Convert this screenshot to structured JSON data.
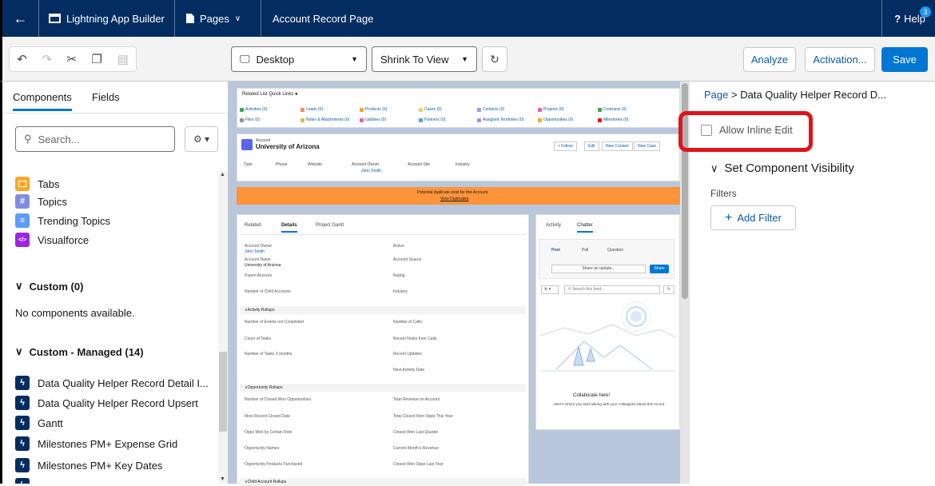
{
  "topbar": {
    "app_title": "Lightning App Builder",
    "pages_label": "Pages",
    "record_title": "Account Record Page",
    "help_label": "Help",
    "help_badge": "3"
  },
  "toolbar": {
    "device": "Desktop",
    "view": "Shrink To View",
    "analyze": "Analyze",
    "activation": "Activation...",
    "save": "Save"
  },
  "left": {
    "tab_components": "Components",
    "tab_fields": "Fields",
    "search_placeholder": "Search...",
    "items": [
      {
        "label": "Tabs",
        "color": "#f9a825",
        "glyph": ""
      },
      {
        "label": "Topics",
        "color": "#7f8de1",
        "glyph": "#"
      },
      {
        "label": "Trending Topics",
        "color": "#5a9cff",
        "glyph": "≡"
      },
      {
        "label": "Visualforce",
        "color": "#9c27e0",
        "glyph": "</>"
      }
    ],
    "custom_header": "Custom (0)",
    "no_components": "No components available.",
    "managed_header": "Custom - Managed (14)",
    "managed_items": [
      "Data Quality Helper Record Detail I...",
      "Data Quality Helper Record Upsert",
      "Gantt",
      "Milestones PM+ Expense Grid",
      "Milestones PM+ Key Dates"
    ],
    "managed_color": "#032d60"
  },
  "canvas": {
    "quick_links_title": "Related List Quick Links",
    "quick_links": [
      {
        "label": "Activities (0)",
        "color": "#3ba755"
      },
      {
        "label": "Leads (0)",
        "color": "#f88962"
      },
      {
        "label": "Products (0)",
        "color": "#f9a825"
      },
      {
        "label": "Cases (0)",
        "color": "#f2cf5b"
      },
      {
        "label": "Contacts (0)",
        "color": "#a094ed"
      },
      {
        "label": "Projects (0)",
        "color": "#e55fb8"
      },
      {
        "label": "Contracts (0)",
        "color": "#3ba755"
      },
      {
        "label": "Files (0)",
        "color": "#939393"
      },
      {
        "label": "Notes & Attachments (0)",
        "color": "#e2b745"
      },
      {
        "label": "Updates (0)",
        "color": "#e55fb8"
      },
      {
        "label": "Partners (0)",
        "color": "#5a9cff"
      },
      {
        "label": "Assigned Territories (0)",
        "color": "#a094ed"
      },
      {
        "label": "Opportunities (0)",
        "color": "#f9a825"
      },
      {
        "label": "Milestones (0)",
        "color": "#e0131a"
      }
    ],
    "account_label": "Account",
    "account_name": "University of Arizona",
    "header_buttons": [
      "+ Follow",
      "Edit",
      "New Contact",
      "New Case"
    ],
    "highlight_fields": [
      "Type",
      "Phone",
      "Website",
      "Account Owner",
      "Account Site",
      "Industry"
    ],
    "owner": "John Smith",
    "dup_warning": "Potential duplicate exist for this Account.",
    "dup_link": "View Duplicates",
    "detail_tabs": [
      "Related",
      "Details",
      "Project Gantt"
    ],
    "details_left": [
      {
        "label": "Account Owner",
        "value": "John Smith"
      },
      {
        "label": "Account Name",
        "value": "University of Arizona"
      },
      {
        "label": "Parent Account",
        "value": ""
      },
      {
        "label": "Number of Child Accounts",
        "value": ""
      }
    ],
    "details_right": [
      "Active",
      "Account Source",
      "Rating",
      "Industry"
    ],
    "activity_rollups": "Activity Rollups",
    "activity_left": [
      "Number of Events not Completed",
      "Count of Tasks",
      "Number of Tasks 3 months"
    ],
    "activity_right": [
      "Number of Calls",
      "Recent Notes from Calls",
      "Recent Updates",
      "Next Activity Date"
    ],
    "opp_rollups": "Opportunity Rollups",
    "opp_left": [
      "Number of Closed Won Opportunities",
      "Most Recent Closed Date",
      "Opps Won by Certain Role",
      "Opportunity Names",
      "Opportunity Products Purchased"
    ],
    "opp_right": [
      "Total Revenue on Account",
      "Total Closed Won Opps This Year",
      "Closed Won Last Quarter",
      "Current Month's Revenue",
      "Closed Won Opps Last Year"
    ],
    "child_rollups": "Child Account Rollups",
    "feed_tabs": [
      "Activity",
      "Chatter"
    ],
    "post_tabs": [
      "Post",
      "Poll",
      "Question"
    ],
    "share_placeholder": "Share an update...",
    "share_btn": "Share",
    "search_feed": "Search this feed...",
    "collab_title": "Collaborate here!",
    "collab_text": "Here's where you start talking with your colleagues about this record."
  },
  "right": {
    "crumb_page": "Page",
    "crumb_sep": ">",
    "crumb_title": "Data Quality Helper Record D...",
    "inline_edit": "Allow Inline Edit",
    "visibility": "Set Component Visibility",
    "filters": "Filters",
    "add_filter": "Add Filter"
  }
}
